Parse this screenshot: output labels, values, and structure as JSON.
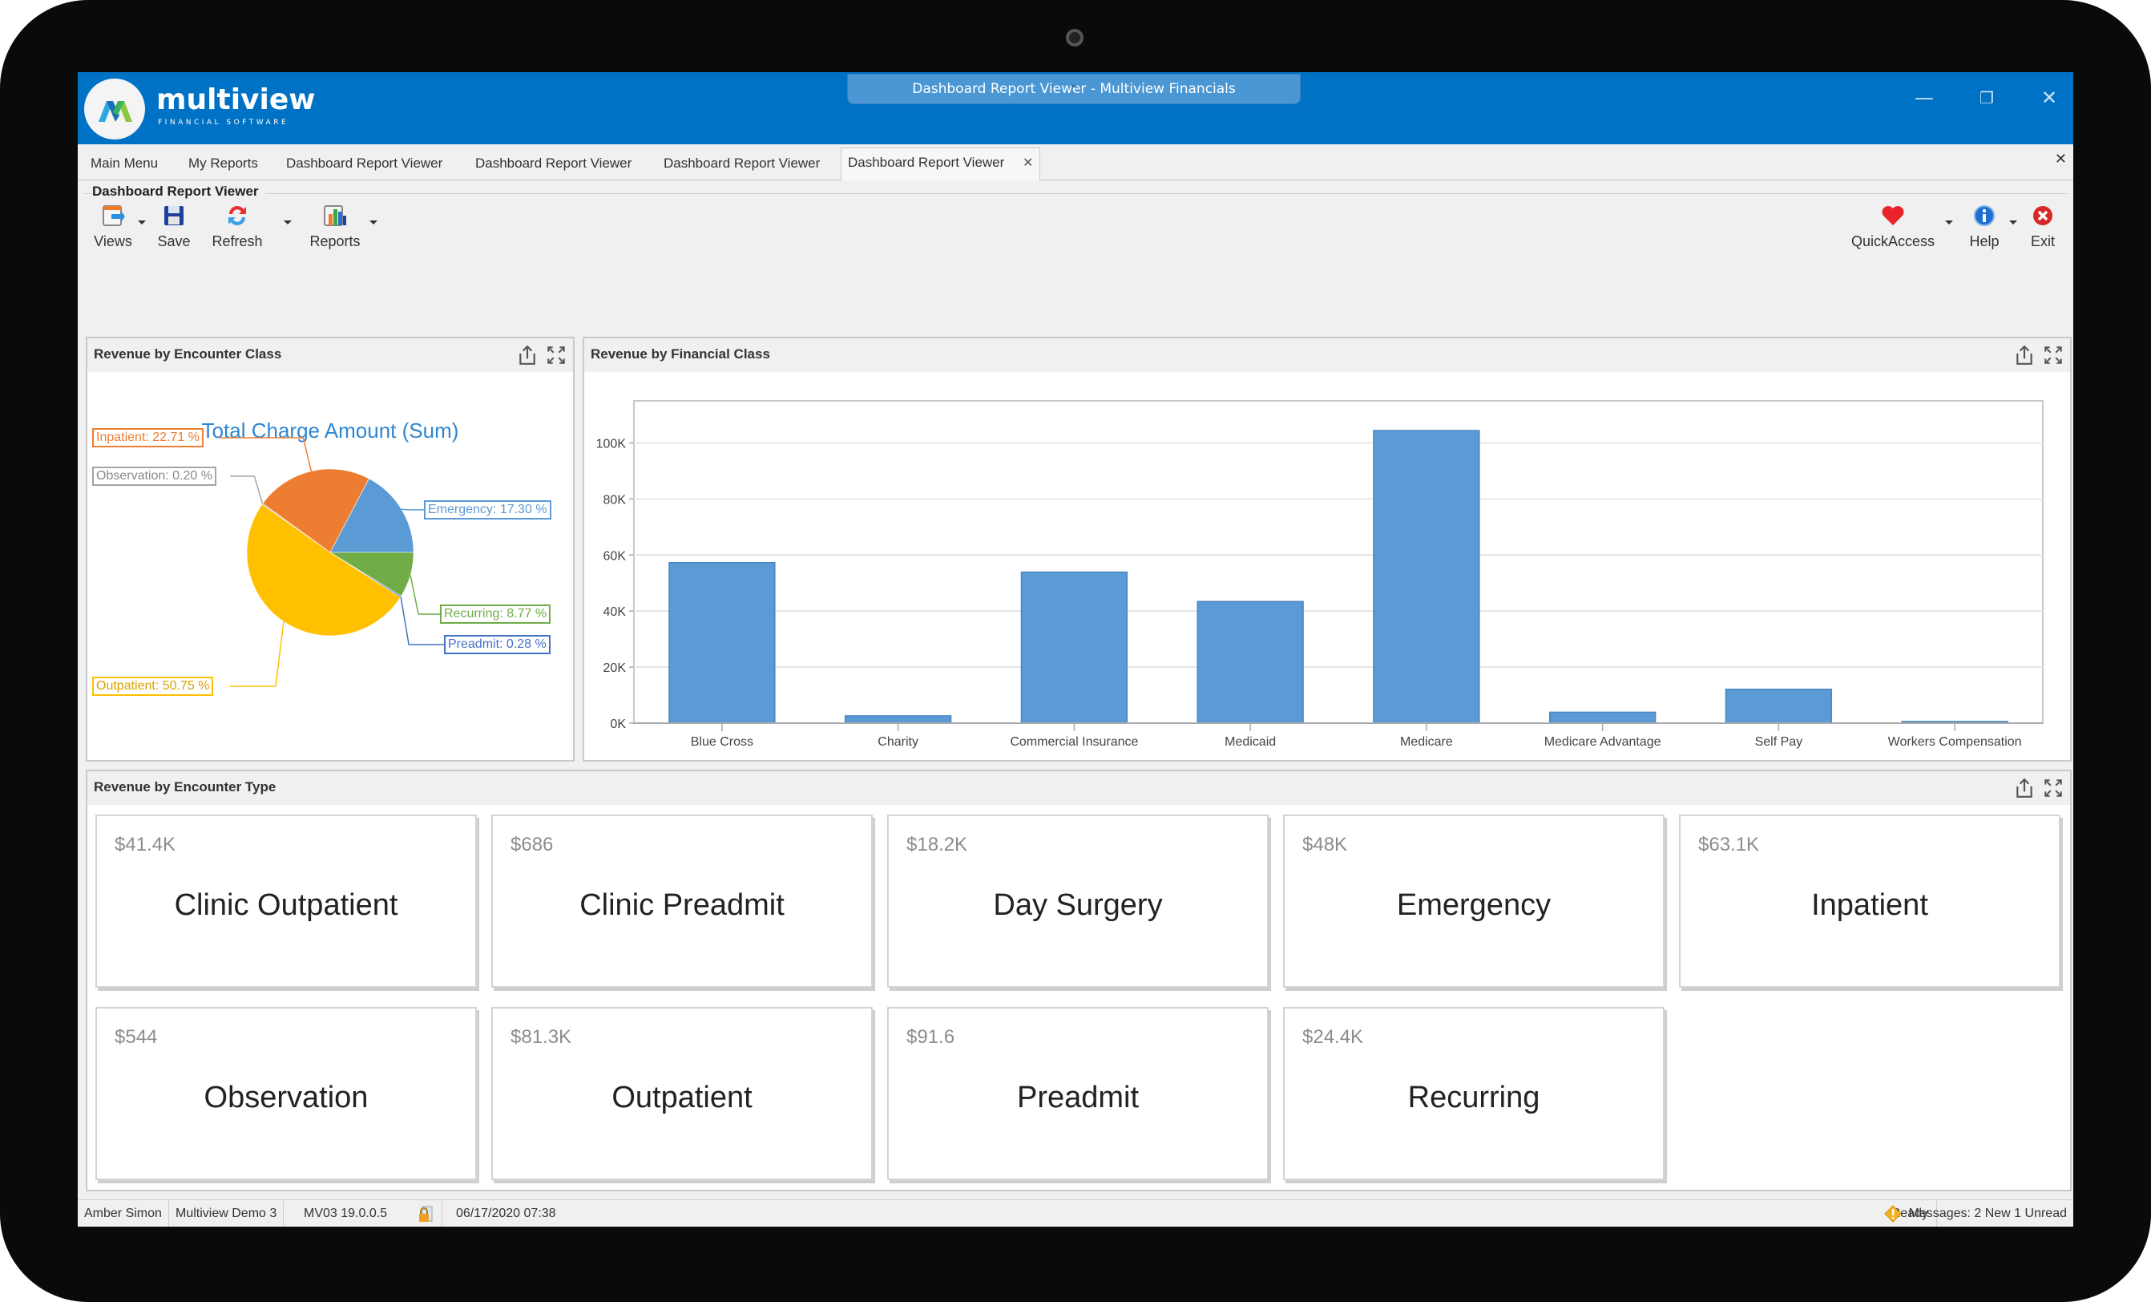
{
  "window": {
    "title": "Dashboard Report Viewer - Multiview Financials",
    "brand": "multiview",
    "brand_sub": "FINANCIAL SOFTWARE",
    "minimize_glyph": "—",
    "restore_glyph": "❐",
    "close_glyph": "✕"
  },
  "tabs": [
    {
      "label": "Main Menu",
      "active": false
    },
    {
      "label": "My Reports",
      "active": false
    },
    {
      "label": "Dashboard Report Viewer",
      "active": false
    },
    {
      "label": "Dashboard Report Viewer",
      "active": false
    },
    {
      "label": "Dashboard Report Viewer",
      "active": false
    },
    {
      "label": "Dashboard Report Viewer",
      "active": true
    }
  ],
  "tab_close_glyph": "✕",
  "ribbon": {
    "group_title": "Dashboard Report Viewer",
    "left_buttons": [
      {
        "label": "Views",
        "icon": "views-icon",
        "dropdown": true
      },
      {
        "label": "Save",
        "icon": "save-icon",
        "dropdown": false
      },
      {
        "label": "Refresh",
        "icon": "refresh-icon",
        "dropdown": true
      },
      {
        "label": "Reports",
        "icon": "reports-icon",
        "dropdown": true
      }
    ],
    "right_buttons": [
      {
        "label": "QuickAccess",
        "icon": "heart-icon",
        "dropdown": true
      },
      {
        "label": "Help",
        "icon": "info-icon",
        "dropdown": true
      },
      {
        "label": "Exit",
        "icon": "exit-icon",
        "dropdown": false
      }
    ]
  },
  "panels": {
    "encounter_class": {
      "title": "Revenue by Encounter Class"
    },
    "financial_class": {
      "title": "Revenue by Financial Class"
    },
    "encounter_type": {
      "title": "Revenue by Encounter Type"
    }
  },
  "chart_data": [
    {
      "type": "pie",
      "title": "Total Charge Amount (Sum)",
      "slices": [
        {
          "label": "Emergency",
          "value": 17.3,
          "display": "Emergency: 17.30 %",
          "color": "#5b9bd5"
        },
        {
          "label": "Recurring",
          "value": 8.77,
          "display": "Recurring: 8.77 %",
          "color": "#70ad47"
        },
        {
          "label": "Preadmit",
          "value": 0.28,
          "display": "Preadmit: 0.28 %",
          "color": "#4472c4"
        },
        {
          "label": "Outpatient",
          "value": 50.75,
          "display": "Outpatient: 50.75 %",
          "color": "#ffc000"
        },
        {
          "label": "Observation",
          "value": 0.2,
          "display": "Observation: 0.20 %",
          "color": "#a5a5a5"
        },
        {
          "label": "Inpatient",
          "value": 22.71,
          "display": "Inpatient: 22.71 %",
          "color": "#ed7d31"
        }
      ],
      "legend": "none"
    },
    {
      "type": "bar",
      "title": "Revenue by Financial Class",
      "categories": [
        "Blue Cross",
        "Charity",
        "Commercial Insurance",
        "Medicaid",
        "Medicare",
        "Medicare Advantage",
        "Self Pay",
        "Workers Compensation"
      ],
      "values": [
        57300,
        2600,
        53900,
        43400,
        104400,
        3900,
        12100,
        600
      ],
      "yticks": [
        "0K",
        "20K",
        "40K",
        "60K",
        "80K",
        "100K"
      ],
      "ylim": [
        0,
        115000
      ],
      "xlabel": "",
      "ylabel": "",
      "grid": true,
      "bar_color": "#5b9bd5"
    }
  ],
  "encounter_types": [
    {
      "value": "$41.4K",
      "name": "Clinic Outpatient"
    },
    {
      "value": "$686",
      "name": "Clinic Preadmit"
    },
    {
      "value": "$18.2K",
      "name": "Day Surgery"
    },
    {
      "value": "$48K",
      "name": "Emergency"
    },
    {
      "value": "$63.1K",
      "name": "Inpatient"
    },
    {
      "value": "$544",
      "name": "Observation"
    },
    {
      "value": "$81.3K",
      "name": "Outpatient"
    },
    {
      "value": "$91.6",
      "name": "Preadmit"
    },
    {
      "value": "$24.4K",
      "name": "Recurring"
    }
  ],
  "status": {
    "user": "Amber Simon",
    "company": "Multiview Demo 3",
    "version": "MV03 19.0.0.5",
    "datetime": "06/17/2020 07:38",
    "ready": "Ready",
    "messages": "Messages: 2 New 1 Unread"
  }
}
